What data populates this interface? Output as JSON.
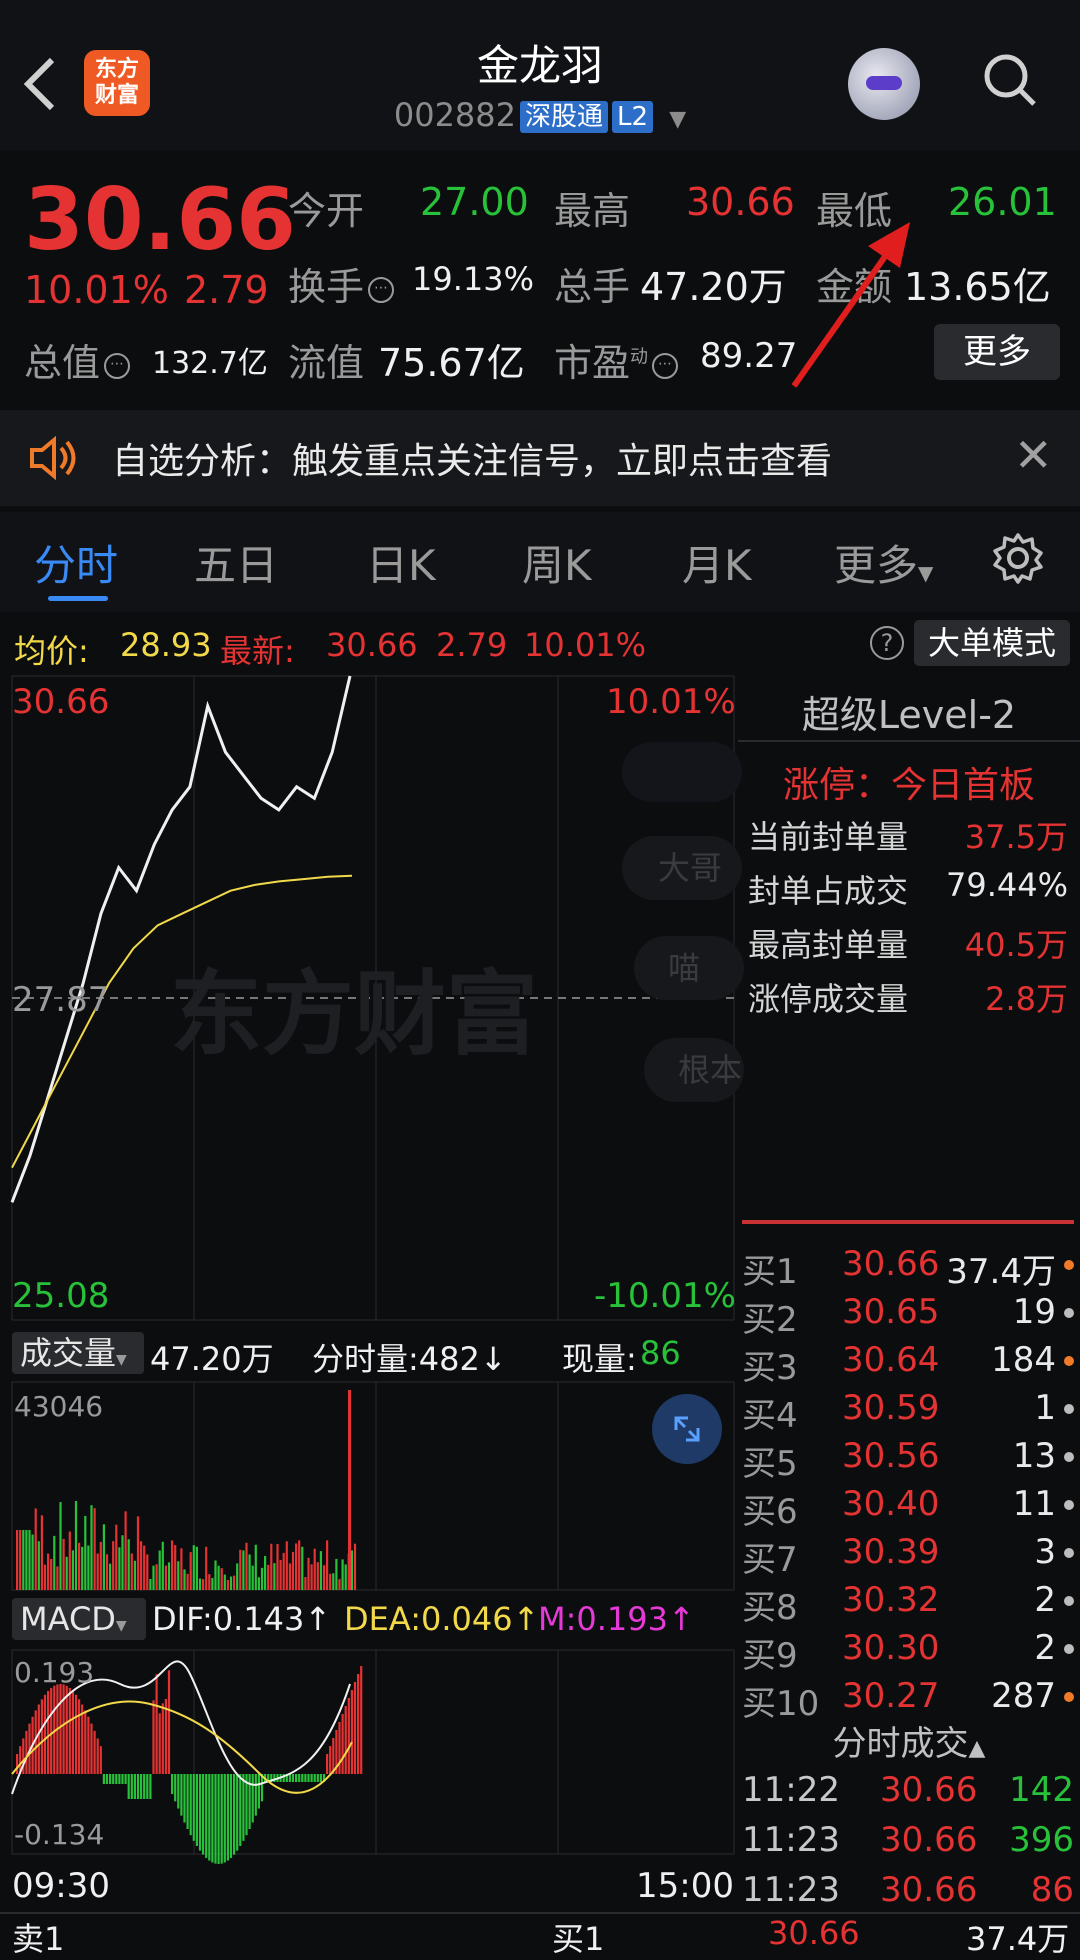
{
  "header": {
    "back_icon": "chevron-left-icon",
    "logo_line1": "东方",
    "logo_line2": "财富",
    "name": "金龙羽",
    "code": "002882",
    "tag_connect": "深股通",
    "tag_level": "L2",
    "dropdown_icon": "caret-down-icon",
    "avatar_icon": "robot-avatar-icon",
    "search_icon": "search-icon"
  },
  "quote": {
    "price": "30.66",
    "change_pct": "10.01%",
    "change_amt": "2.79",
    "open_label": "今开",
    "open": "27.00",
    "high_label": "最高",
    "high": "30.66",
    "low_label": "最低",
    "low": "26.01",
    "turnover_label": "换手",
    "turnover": "19.13%",
    "volume_label": "总手",
    "volume": "47.20万",
    "amount_label": "金额",
    "amount": "13.65亿",
    "mktcap_label": "总值",
    "mktcap": "132.7亿",
    "float_label": "流值",
    "float": "75.67亿",
    "pe_label": "市盈",
    "pe_sup": "动",
    "pe": "89.27",
    "more_label": "更多"
  },
  "banner": {
    "text": "自选分析：触发重点关注信号，立即点击查看",
    "close": "✕"
  },
  "tabs": [
    "分时",
    "五日",
    "日K",
    "周K",
    "月K",
    "更多"
  ],
  "infobar": {
    "avg_label": "均价:",
    "avg": "28.93",
    "latest_label": "最新:",
    "latest": "30.66",
    "latest_chg": "2.79",
    "latest_pct": "10.01%",
    "help": "?",
    "big_order_label": "大单模式"
  },
  "chart": {
    "y_top": "30.66",
    "y_mid": "27.87",
    "y_bot": "25.08",
    "pct_top": "10.01%",
    "pct_bot": "-10.01%",
    "watermark": "东方财富",
    "side_chips": [
      "大哥",
      "喵",
      "根本"
    ],
    "vol_label": "成交量",
    "vol_total": "47.20万",
    "vol_min_label": "分时量:482↓",
    "vol_now_label": "现量:",
    "vol_now": "86",
    "vol_max": "43046",
    "macd_label": "MACD",
    "dif": "DIF:0.143↑",
    "dea": "DEA:0.046↑",
    "m": "M:0.193↑",
    "macd_top": "0.193",
    "macd_bot": "-0.134",
    "time_start": "09:30",
    "time_end": "15:00"
  },
  "chart_data": {
    "type": "line",
    "price_range": [
      25.08,
      30.66
    ],
    "prev_close": 27.87,
    "series": [
      {
        "values": [
          26.1,
          26.5,
          27.0,
          27.5,
          28.0,
          28.6,
          29.0,
          28.8,
          29.2,
          29.5,
          29.7,
          30.4,
          30.0,
          29.8,
          29.6,
          29.5,
          29.7,
          29.6,
          30.0,
          30.66
        ]
      },
      {
        "values": [
          26.4,
          26.8,
          27.2,
          27.6,
          28.0,
          28.3,
          28.5,
          28.6,
          28.7,
          28.8,
          28.85,
          28.88,
          28.9,
          28.92,
          28.93
        ]
      }
    ]
  },
  "level2": {
    "title": "超级Level-2",
    "limit_title": "涨停：今日首板",
    "rows": [
      {
        "label": "当前封单量",
        "value": "37.5万",
        "color": "#e53333"
      },
      {
        "label": "封单占成交",
        "value": "79.44%",
        "color": "#eaeaea"
      },
      {
        "label": "最高封单量",
        "value": "40.5万",
        "color": "#e53333"
      },
      {
        "label": "涨停成交量",
        "value": "2.8万",
        "color": "#e53333"
      }
    ]
  },
  "bids": [
    {
      "label": "买1",
      "price": "30.66",
      "vol": "37.4万",
      "dot": "#ef7b2a"
    },
    {
      "label": "买2",
      "price": "30.65",
      "vol": "19",
      "dot": "#bdbdbd"
    },
    {
      "label": "买3",
      "price": "30.64",
      "vol": "184",
      "dot": "#ef7b2a"
    },
    {
      "label": "买4",
      "price": "30.59",
      "vol": "1",
      "dot": "#bdbdbd"
    },
    {
      "label": "买5",
      "price": "30.56",
      "vol": "13",
      "dot": "#bdbdbd"
    },
    {
      "label": "买6",
      "price": "30.40",
      "vol": "11",
      "dot": "#bdbdbd"
    },
    {
      "label": "买7",
      "price": "30.39",
      "vol": "3",
      "dot": "#bdbdbd"
    },
    {
      "label": "买8",
      "price": "30.32",
      "vol": "2",
      "dot": "#bdbdbd"
    },
    {
      "label": "买9",
      "price": "30.30",
      "vol": "2",
      "dot": "#bdbdbd"
    },
    {
      "label": "买10",
      "price": "30.27",
      "vol": "287",
      "dot": "#ef7b2a"
    }
  ],
  "trades": {
    "title": "分时成交",
    "rows": [
      {
        "time": "11:22",
        "price": "30.66",
        "vol": "142",
        "color": "#28c23a"
      },
      {
        "time": "11:23",
        "price": "30.66",
        "vol": "396",
        "color": "#28c23a"
      },
      {
        "time": "11:23",
        "price": "30.66",
        "vol": "86",
        "color": "#e53333"
      }
    ]
  },
  "bottom": {
    "sell_label": "卖1",
    "buy_label": "买1",
    "buy_price": "30.66",
    "buy_vol": "37.4万"
  }
}
